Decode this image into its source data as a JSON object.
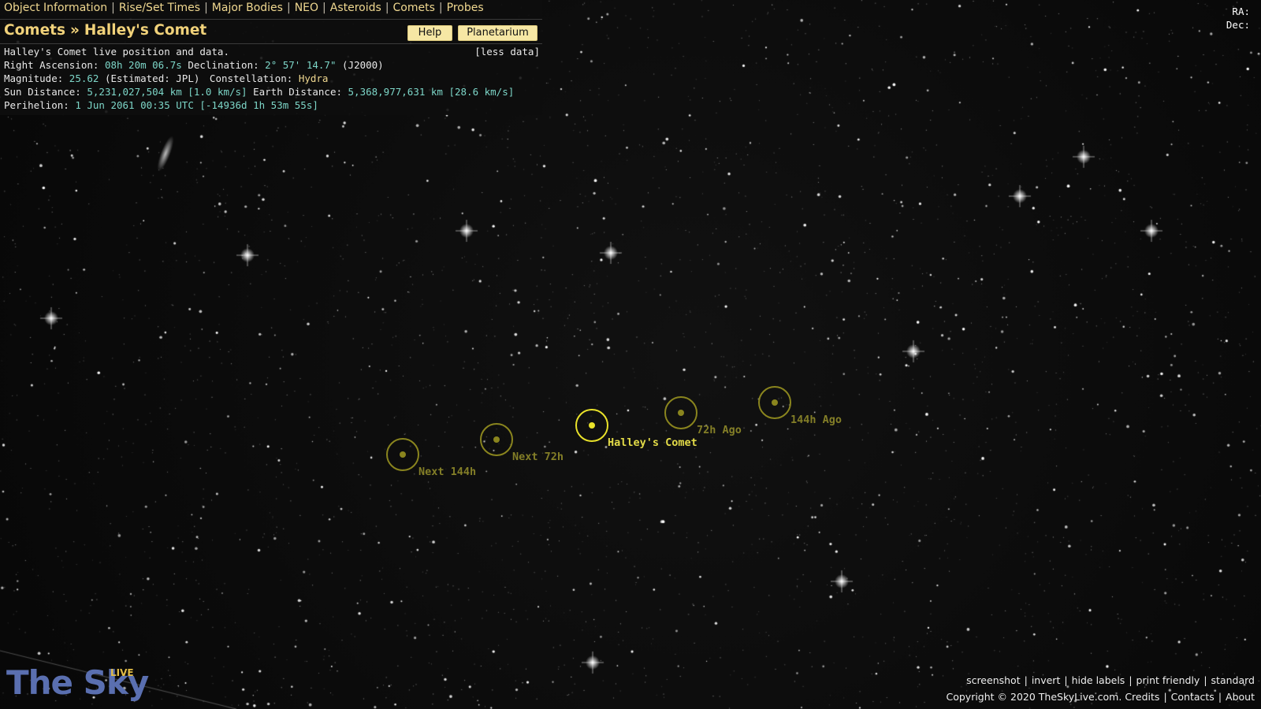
{
  "nav": {
    "items": [
      "Object Information",
      "Rise/Set Times",
      "Major Bodies",
      "NEO",
      "Asteroids",
      "Comets",
      "Probes"
    ],
    "separator": "|"
  },
  "title": {
    "category": "Comets",
    "separator": "»",
    "object": "Halley's Comet"
  },
  "buttons": {
    "help": "Help",
    "planetarium": "Planetarium"
  },
  "info": {
    "intro": "Halley's Comet live position and data.",
    "less_data": "[less data]",
    "ra_label": "Right Ascension:",
    "ra_value": "08h 20m 06.7s",
    "dec_label": "Declination:",
    "dec_value": "2° 57' 14.7\"",
    "epoch": "(J2000)",
    "mag_label": "Magnitude:",
    "mag_value": "25.62",
    "mag_note": "(Estimated: JPL)",
    "const_label": "Constellation:",
    "const_value": "Hydra",
    "sun_label": "Sun Distance:",
    "sun_value": "5,231,027,504 km [1.0 km/s]",
    "earth_label": "Earth Distance:",
    "earth_value": "5,368,977,631 km [28.6 km/s]",
    "peri_label": "Perihelion:",
    "peri_value": "1 Jun 2061 00:35 UTC [-14936d 1h 53m 55s]"
  },
  "radec": {
    "ra": "RA:",
    "dec": "Dec:"
  },
  "markers": [
    {
      "label": "Next 144h"
    },
    {
      "label": "Next 72h"
    },
    {
      "label": "Halley's Comet"
    },
    {
      "label": "72h Ago"
    },
    {
      "label": "144h Ago"
    }
  ],
  "logo": {
    "text": "The Sky",
    "badge": "LIVE"
  },
  "footer": {
    "links": [
      "screenshot",
      "invert",
      "hide labels",
      "print friendly",
      "standard"
    ],
    "copyright": "Copyright © 2020 TheSkyLive.com.",
    "meta_links": [
      "Credits",
      "Contacts",
      "About"
    ]
  },
  "colors": {
    "accent": "#f1d27a",
    "marker": "#8a851e",
    "marker_current": "#e9e22a",
    "value": "#7dd6c8",
    "logo": "#5a6fb0"
  }
}
